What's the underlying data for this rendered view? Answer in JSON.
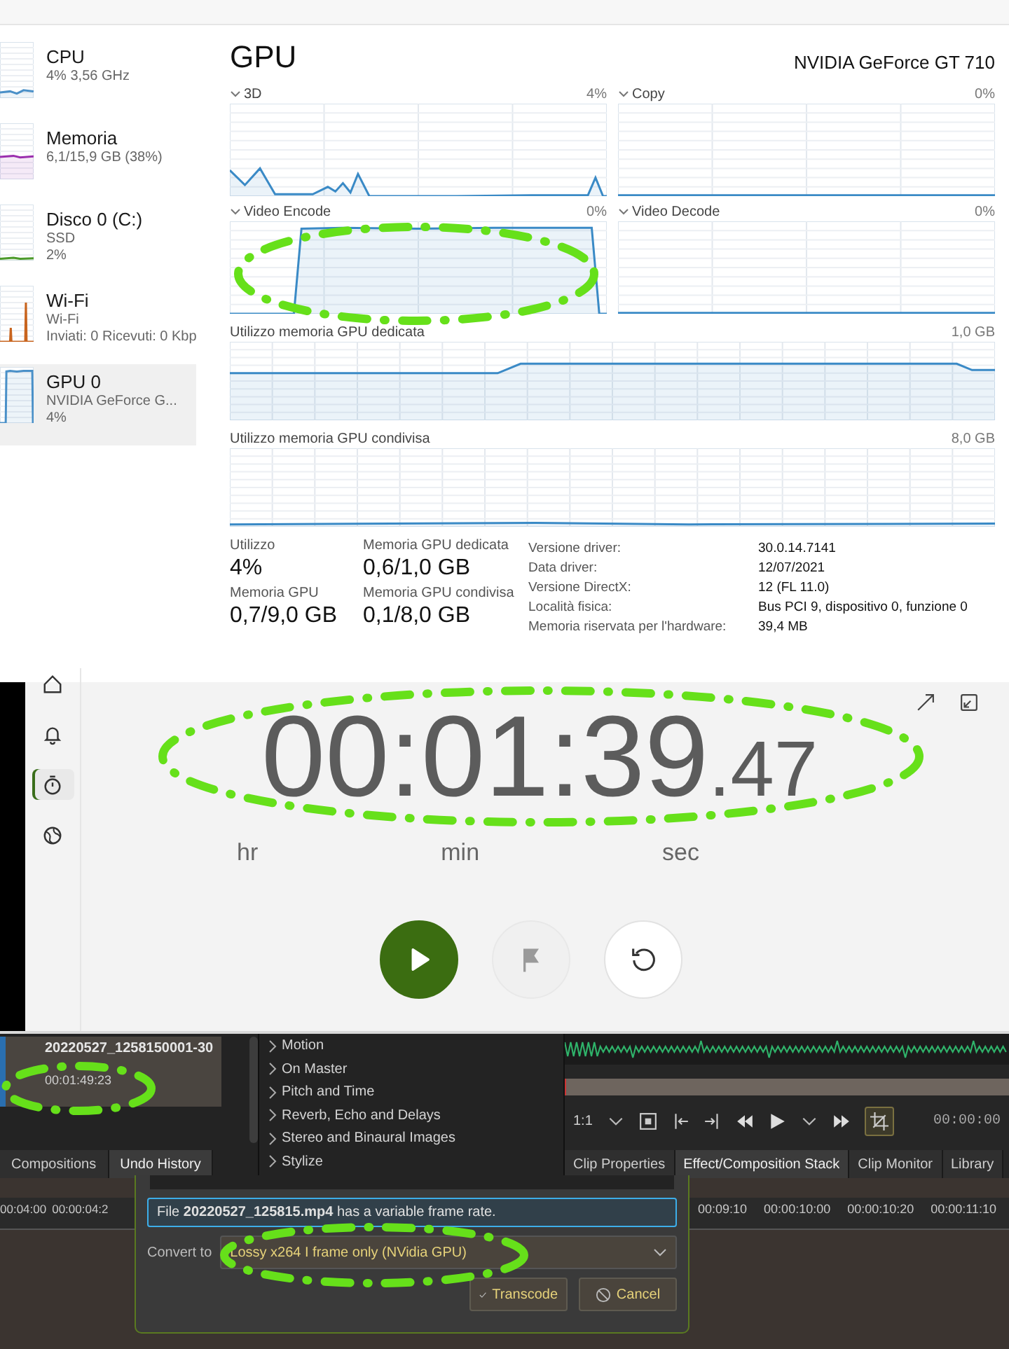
{
  "task_manager": {
    "sidebar": [
      {
        "name": "CPU",
        "lines": [
          "4% 3,56 GHz"
        ],
        "color": "#4a90c8",
        "kind": "low",
        "selected": false
      },
      {
        "name": "Memoria",
        "lines": [
          "6,1/15,9 GB (38%)"
        ],
        "color": "#9b2fae",
        "kind": "mid",
        "selected": false
      },
      {
        "name": "Disco 0 (C:)",
        "lines": [
          "SSD",
          "2%"
        ],
        "color": "#4c9a2a",
        "kind": "bottom",
        "selected": false
      },
      {
        "name": "Wi-Fi",
        "lines": [
          "Wi-Fi",
          "Inviati: 0 Ricevuti: 0 Kbp"
        ],
        "color": "#c8641e",
        "kind": "spikes",
        "selected": false
      },
      {
        "name": "GPU 0",
        "lines": [
          "NVIDIA GeForce G...",
          "4%"
        ],
        "color": "#4a90c8",
        "kind": "plateau",
        "selected": true
      }
    ],
    "title": "GPU",
    "model": "NVIDIA GeForce GT 710",
    "engines": [
      {
        "label": "3D",
        "value": "4%",
        "kind": "spiky"
      },
      {
        "label": "Copy",
        "value": "0%",
        "kind": "flat"
      },
      {
        "label": "Video Encode",
        "value": "0%",
        "kind": "plateau"
      },
      {
        "label": "Video Decode",
        "value": "0%",
        "kind": "flat"
      }
    ],
    "memory_graphs": [
      {
        "label": "Utilizzo memoria GPU dedicata",
        "value": "1,0 GB",
        "kind": "step"
      },
      {
        "label": "Utilizzo memoria GPU condivisa",
        "value": "8,0 GB",
        "kind": "bottom"
      }
    ],
    "stats": [
      {
        "label": "Utilizzo",
        "value": "4%"
      },
      {
        "label": "Memoria GPU dedicata",
        "value": "0,6/1,0 GB"
      },
      {
        "label": "Memoria GPU",
        "value": "0,7/9,0 GB"
      },
      {
        "label": "Memoria GPU condivisa",
        "value": "0,1/8,0 GB"
      }
    ],
    "details": [
      {
        "label": "Versione driver:",
        "value": "30.0.14.7141"
      },
      {
        "label": "Data driver:",
        "value": "12/07/2021"
      },
      {
        "label": "Versione DirectX:",
        "value": "12 (FL 11.0)"
      },
      {
        "label": "Località fisica:",
        "value": "Bus PCI 9, dispositivo 0, funzione 0"
      },
      {
        "label": "Memoria riservata per l'hardware:",
        "value": "39,4 MB"
      }
    ]
  },
  "stopwatch": {
    "nav": [
      {
        "kind": "home",
        "selected": false
      },
      {
        "kind": "bell",
        "selected": false
      },
      {
        "kind": "stopwatch",
        "selected": true
      },
      {
        "kind": "globe",
        "selected": false
      }
    ],
    "time": "00:01:39",
    "fraction": ".47",
    "units": [
      "hr",
      "min",
      "sec"
    ],
    "controls": [
      {
        "kind": "play",
        "disabled": false
      },
      {
        "kind": "flag",
        "disabled": true
      },
      {
        "kind": "reset",
        "disabled": false
      }
    ]
  },
  "editor": {
    "clip": {
      "name": "20220527_1258150001-30",
      "duration": "00:01:49:23"
    },
    "left_tabs": [
      {
        "label": "Compositions",
        "selected": false
      },
      {
        "label": "Undo History",
        "selected": true
      }
    ],
    "effects": [
      "Motion",
      "On Master",
      "Pitch and Time",
      "Reverb, Echo and Delays",
      "Stereo and Binaural Images",
      "Stylize"
    ],
    "monitor": {
      "zoom": "1:1",
      "timecode": "00:00:00"
    },
    "right_tabs": [
      {
        "label": "Clip Properties",
        "selected": false
      },
      {
        "label": "Effect/Composition Stack",
        "selected": true
      },
      {
        "label": "Clip Monitor",
        "selected": false
      },
      {
        "label": "Library",
        "selected": false
      }
    ],
    "ruler": {
      "left": [
        "00:04:00",
        "00:00:04:2"
      ],
      "right": [
        "00:09:10",
        "00:00:10:00",
        "00:00:10:20",
        "00:00:11:10"
      ]
    },
    "dialog": {
      "message": "File **20220527_125815.mp4** has a variable frame rate.",
      "convert_label": "Convert to",
      "profile": "Lossy x264 I frame only (NVidia GPU)",
      "buttons": [
        {
          "label": "Transcode",
          "kind": "confirm"
        },
        {
          "label": "Cancel",
          "kind": "cancel"
        }
      ]
    }
  }
}
